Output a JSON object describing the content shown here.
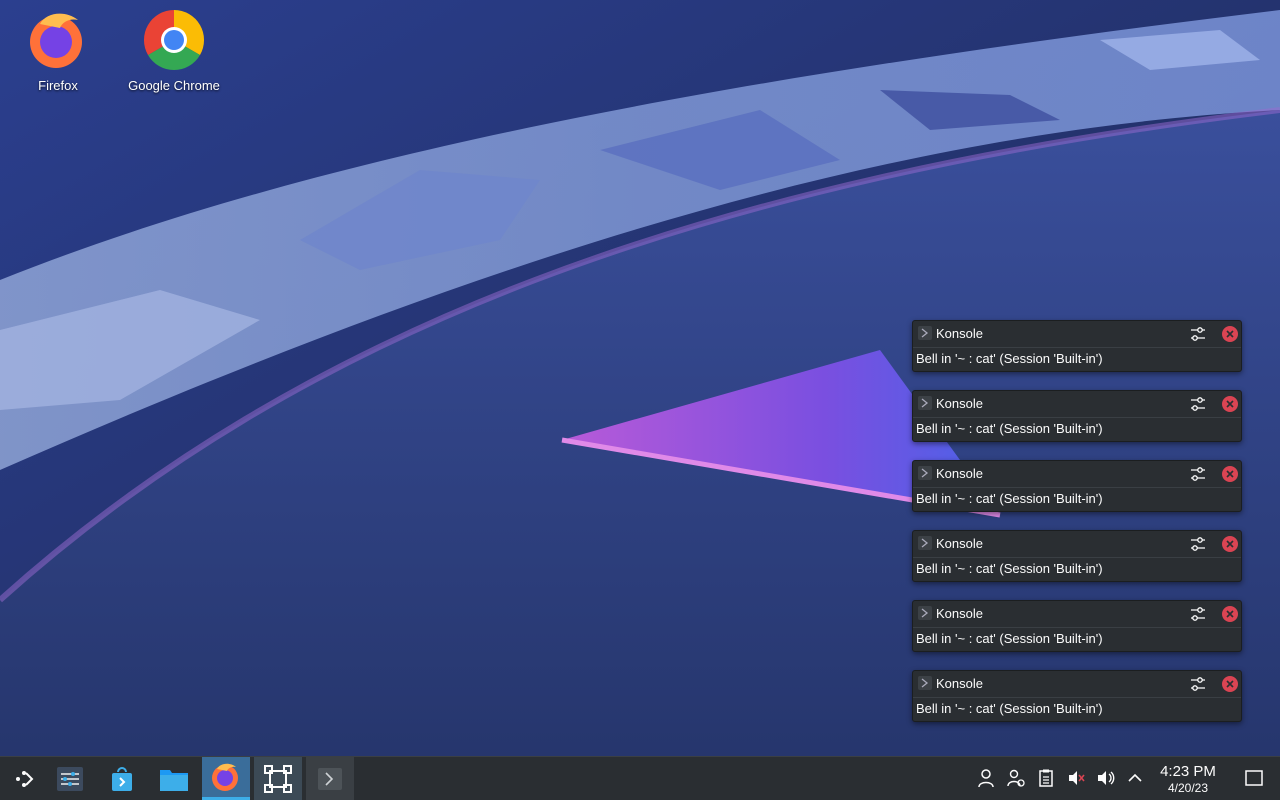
{
  "desktop": {
    "icons": [
      {
        "label": "Firefox",
        "icon": "firefox-icon"
      },
      {
        "label": "Google Chrome",
        "icon": "chrome-icon"
      }
    ]
  },
  "notifications": [
    {
      "app": "Konsole",
      "message": "Bell in '~ : cat' (Session 'Built-in')"
    },
    {
      "app": "Konsole",
      "message": "Bell in '~ : cat' (Session 'Built-in')"
    },
    {
      "app": "Konsole",
      "message": "Bell in '~ : cat' (Session 'Built-in')"
    },
    {
      "app": "Konsole",
      "message": "Bell in '~ : cat' (Session 'Built-in')"
    },
    {
      "app": "Konsole",
      "message": "Bell in '~ : cat' (Session 'Built-in')"
    },
    {
      "app": "Konsole",
      "message": "Bell in '~ : cat' (Session 'Built-in')"
    }
  ],
  "taskbar": {
    "launchers": [
      "application-launcher-icon",
      "system-settings-icon",
      "discover-store-icon",
      "file-manager-icon",
      "firefox-icon",
      "window-manager-icon",
      "konsole-icon"
    ],
    "tray": [
      "user-icon",
      "user-switch-icon",
      "clipboard-icon",
      "microphone-muted-icon",
      "volume-icon",
      "chevron-up-icon"
    ],
    "clock": {
      "time": "4:23 PM",
      "date": "4/20/23"
    },
    "show_desktop": "show-desktop-icon"
  },
  "colors": {
    "panel": "#2a2e32",
    "accent": "#3daee9",
    "close_red": "#da4453"
  }
}
